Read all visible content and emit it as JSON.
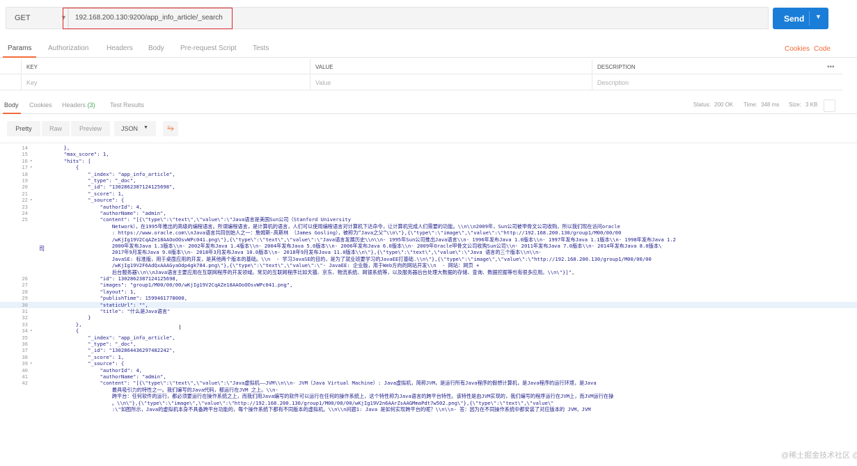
{
  "request": {
    "method": "GET",
    "url": "192.168.200.130:9200/app_info_article/_search",
    "send_label": "Send"
  },
  "request_tabs": [
    "Params",
    "Authorization",
    "Headers",
    "Body",
    "Pre-request Script",
    "Tests"
  ],
  "request_tab_links": [
    "Cookies",
    "Code"
  ],
  "params": {
    "headers": [
      "KEY",
      "VALUE",
      "DESCRIPTION"
    ],
    "placeholders": [
      "Key",
      "Value",
      "Description"
    ],
    "more": "•••"
  },
  "response": {
    "tabs": [
      "Body",
      "Cookies",
      "Headers",
      "Test Results"
    ],
    "headers_count": "(3)",
    "status_label": "Status:",
    "status_value": "200 OK",
    "time_label": "Time:",
    "time_value": "348 ms",
    "size_label": "Size:",
    "size_value": "3 KB"
  },
  "format_bar": {
    "buttons": [
      "Pretty",
      "Raw",
      "Preview"
    ],
    "format": "JSON",
    "wrap_icon": "⥱"
  },
  "side_char": "司",
  "watermark": "@稀土掘金技术社区 @菜饼吧",
  "code_lines": [
    {
      "n": "14",
      "f": "",
      "t": "        },"
    },
    {
      "n": "15",
      "f": "",
      "t": "        \"max_score\": 1,"
    },
    {
      "n": "16",
      "f": "▾",
      "t": "        \"hits\": ["
    },
    {
      "n": "17",
      "f": "▾",
      "t": "            {"
    },
    {
      "n": "18",
      "f": "",
      "t": "                \"_index\": \"app_info_article\","
    },
    {
      "n": "19",
      "f": "",
      "t": "                \"_type\": \"_doc\","
    },
    {
      "n": "20",
      "f": "",
      "t": "                \"_id\": \"1302862387124125698\","
    },
    {
      "n": "21",
      "f": "",
      "t": "                \"_score\": 1,"
    },
    {
      "n": "22",
      "f": "▾",
      "t": "                \"_source\": {"
    },
    {
      "n": "23",
      "f": "",
      "t": "                    \"authorId\": 4,"
    },
    {
      "n": "24",
      "f": "",
      "t": "                    \"authorName\": \"admin\","
    },
    {
      "n": "25",
      "f": "",
      "t": "                    \"content\": \"[{\\\"type\\\":\\\"text\\\",\\\"value\\\":\\\"Java语言是美国Sun公司（Stanford University"
    },
    {
      "n": "",
      "f": "",
      "t": "                        Network），在1995年推出的高级的编程语言。所谓编程语言，是计算机的语言，人们可以使用编程语言对计算机下达命令，让计算机完成人们需要的功能。\\\\n\\\\n2009年，Sun公司被甲骨文公司收购，所以我们现在访问oracle"
    },
    {
      "n": "",
      "f": "",
      "t": "                        : https://www.oracle.com\\\\nJava语言共同创始人之一：詹姆斯·高斯林 （James Gosling），被称为“Java之父”\\\\n\\\"},{\\\"type\\\":\\\"image\\\",\\\"value\\\":\\\"http://192.168.200.130/group1/M00/00/00"
    },
    {
      "n": "",
      "f": "",
      "t": "                        /wKjIg19V2CqAZe18AAOoOOsvWPc041.png\\\"},{\\\"type\\\":\\\"text\\\",\\\"value\\\":\\\"Java语言发展历史\\\\n\\\\n- 1995年Sun公司推出Java语言\\\\n- 1996年发布Java 1.0版本\\\\n- 1997年发布Java 1.1版本\\\\n- 1998年发布Java 1.2"
    },
    {
      "n": "",
      "f": "",
      "t": "                        2000年发布Java 1.3版本\\\\n- 2002年发布Java 1.4版本\\\\n- 2004年发布Java 5.0版本\\\\n- 2006年发布Java 6.0版本\\\\n- 2009年Oracle甲骨文公司收购Sun公司\\\\n- 2011年发布Java 7.0版本\\\\n- 2014年发布Java 8.0版本\\"
    },
    {
      "n": "",
      "f": "",
      "t": "                        2017年9月发布Java 9.0版本\\\\n- 2018年3月发布Java 10.0版本\\\\n- 2018年9月发布Java 11.0版本\\\\n\\\"},{\\\"type\\\":\\\"text\\\",\\\"value\\\":\\\"Java 语言的三个版本\\\\n\\\\n-"
    },
    {
      "n": "",
      "f": "",
      "t": "                        JavaSE: 标准版，用于桌面应用的开发，是其他两个版本的基础。\\\\n  - 学习JavaSE的目的，是为了就业班要学习的JavaEE打基础.\\\\n\\\"},{\\\"type\\\":\\\"image\\\",\\\"value\\\":\\\"http://192.168.200.130/group1/M00/00/00"
    },
    {
      "n": "",
      "f": "",
      "t": "                        /wKjIg19V2F6AdQxAAAGyaOdp4gk784.png\\\"},{\\\"type\\\":\\\"text\\\",\\\"value\\\":\\\"- JavaEE: 企业版，用于Web方向的网站开发\\\\n  - 网站：网页 +"
    },
    {
      "n": "",
      "f": "",
      "t": "                        后台服务器\\\\n\\\\nJava语言主要应用在互联网程序的开发领域。常见的互联网程序比如天猫、京东、物流系统、网银系统等，以及服务器后台处理大数据的存储、查询、数据挖掘等也有很多应用。\\\\n\\\"}]\","
    },
    {
      "n": "26",
      "f": "",
      "t": "                    \"id\": 1302862387124125698,"
    },
    {
      "n": "27",
      "f": "",
      "t": "                    \"images\": \"group1/M00/00/00/wKjIg19V2CqAZe18AAOoOOsvWPc041.png\","
    },
    {
      "n": "28",
      "f": "",
      "t": "                    \"layout\": 1,"
    },
    {
      "n": "29",
      "f": "",
      "t": "                    \"publishTime\": 1599461778000,"
    },
    {
      "n": "30",
      "f": "",
      "t": "                    \"staticUrl\": \"\","
    },
    {
      "n": "31",
      "f": "",
      "t": "                    \"title\": \"什么是Java语言\""
    },
    {
      "n": "32",
      "f": "",
      "t": "                }"
    },
    {
      "n": "33",
      "f": "",
      "t": "            },"
    },
    {
      "n": "34",
      "f": "▾",
      "t": "            {"
    },
    {
      "n": "35",
      "f": "",
      "t": "                \"_index\": \"app_info_article\","
    },
    {
      "n": "36",
      "f": "",
      "t": "                \"_type\": \"_doc\","
    },
    {
      "n": "37",
      "f": "",
      "t": "                \"_id\": \"1302864436297482242\","
    },
    {
      "n": "38",
      "f": "",
      "t": "                \"_score\": 1,"
    },
    {
      "n": "39",
      "f": "▾",
      "t": "                \"_source\": {"
    },
    {
      "n": "40",
      "f": "",
      "t": "                    \"authorId\": 4,"
    },
    {
      "n": "41",
      "f": "",
      "t": "                    \"authorName\": \"admin\","
    },
    {
      "n": "42",
      "f": "",
      "t": "                    \"content\": \"[{\\\"type\\\":\\\"text\\\",\\\"value\\\":\\\"Java虚拟机——JVM\\\\n\\\\n- JVM（Java Virtual Machine）: Java虚拟机，简称JVM，是运行所有Java程序的假想计算机，是Java程序的运行环境，是Java"
    },
    {
      "n": "",
      "f": "",
      "t": "                        最具吸引力的特性之一。我们编写的Java代码，都运行在JVM 之上。\\\\n-"
    },
    {
      "n": "",
      "f": "",
      "t": "                        跨平台：任何软件的运行，都必须要运行在操作系统之上，而我们用Java编写的软件可以运行在任何的操作系统上，这个特性称为Java语言的跨平台特性。该特性是由JVM实现的，我们编写的程序运行在JVM上，而JVM运行在操"
    },
    {
      "n": "",
      "f": "",
      "t": "                        。\\\\n\\\"},{\\\"type\\\":\\\"image\\\",\\\"value\\\":\\\"http://192.168.200.130/group1/M00/00/00/wKjIg19V2n6AArZsAAGMmaPdt7w502.png\\\"},{\\\"type\\\":\\\"text\\\",\\\"value\\\""
    },
    {
      "n": "",
      "f": "",
      "t": "                        :\\\"如图所示，Java的虚拟机本身不具备跨平台功能的，每个操作系统下都有不同版本的虚拟机。\\\\n\\\\n问题1: Java 是如何实现跨平台的呢？\\\\n\\\\n- 答：因为在不同操作系统中都安装了对应版本的 JVM，JVM"
    }
  ]
}
